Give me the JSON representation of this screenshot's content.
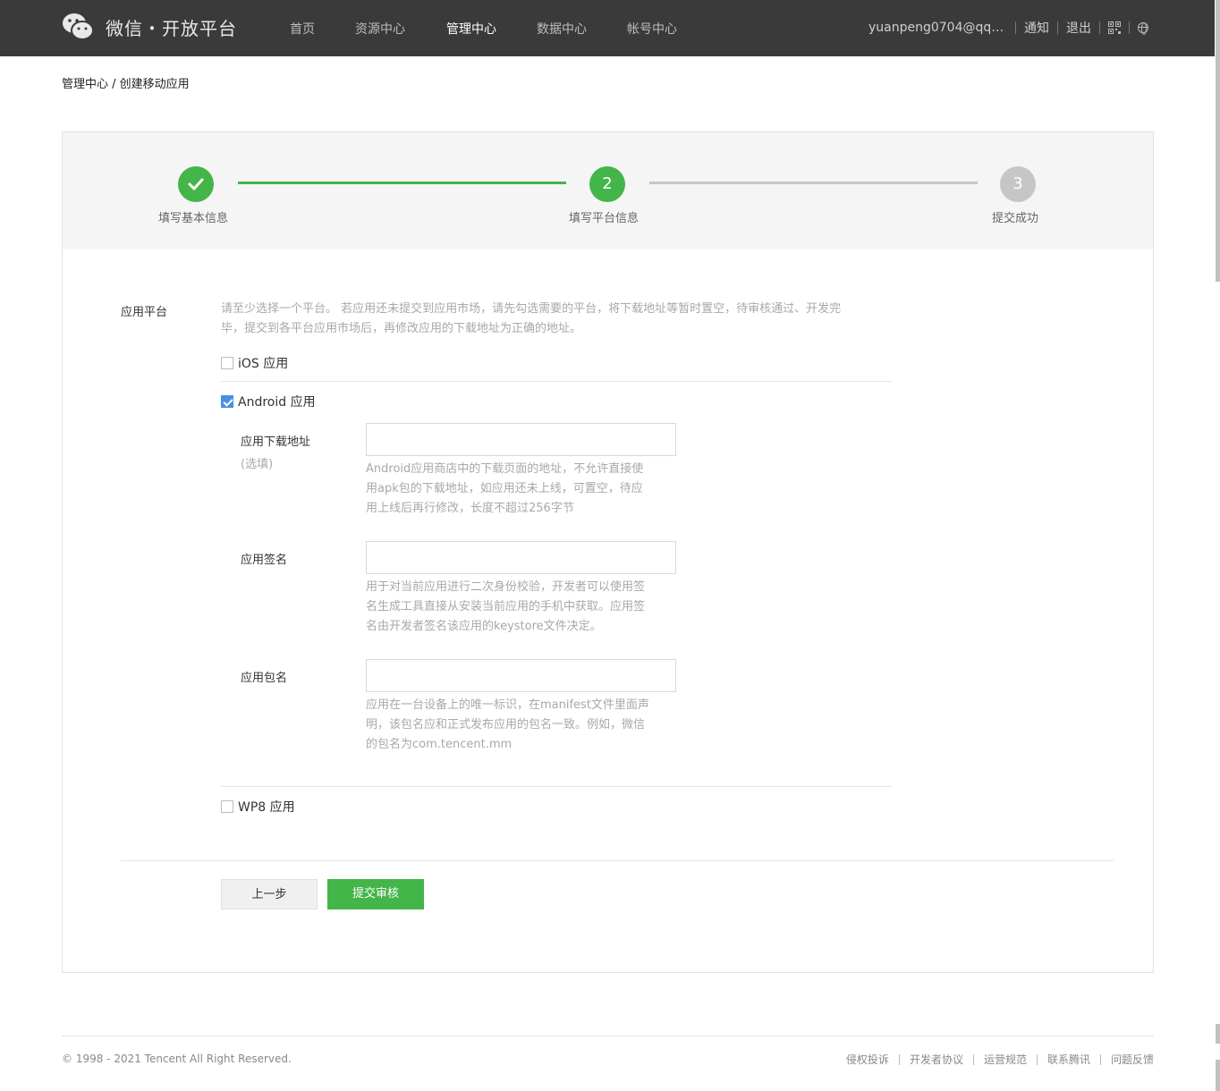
{
  "header": {
    "logo_text": "微信・开放平台",
    "nav": [
      "首页",
      "资源中心",
      "管理中心",
      "数据中心",
      "帐号中心"
    ],
    "active_nav": 2,
    "user_email": "yuanpeng0704@qq.c...",
    "notify": "通知",
    "logout": "退出"
  },
  "breadcrumb": "管理中心 / 创建移动应用",
  "steps": [
    {
      "label": "填写基本信息",
      "number": "",
      "state": "done"
    },
    {
      "label": "填写平台信息",
      "number": "2",
      "state": "current"
    },
    {
      "label": "提交成功",
      "number": "3",
      "state": "todo"
    }
  ],
  "platform": {
    "label": "应用平台",
    "hint_line1": "请至少选择一个平台。 若应用还未提交到应用市场，请先勾选需要的平台，将下载地址等暂时置空，待审核通过、开发完",
    "hint_line2": "毕，提交到各平台应用市场后，再修改应用的下载地址为正确的地址。",
    "ios": {
      "label": "iOS 应用",
      "checked": false
    },
    "android": {
      "label": "Android 应用",
      "checked": true
    },
    "wp8": {
      "label": "WP8 应用",
      "checked": false
    }
  },
  "android_fields": {
    "download": {
      "label": "应用下载地址",
      "optional": "(选填)",
      "value": "",
      "hint": [
        "Android应用商店中的下载页面的地址，不允许直接使",
        "用apk包的下载地址，如应用还未上线，可置空，待应",
        "用上线后再行修改，长度不超过256字节"
      ]
    },
    "signature": {
      "label": "应用签名",
      "value": "",
      "hint": [
        "用于对当前应用进行二次身份校验，开发者可以使用签",
        "名生成工具直接从安装当前应用的手机中获取。应用签",
        "名由开发者签名该应用的keystore文件决定。"
      ]
    },
    "package": {
      "label": "应用包名",
      "value": "",
      "hint": [
        "应用在一台设备上的唯一标识，在manifest文件里面声",
        "明，该包名应和正式发布应用的包名一致。例如，微信",
        "的包名为com.tencent.mm"
      ]
    }
  },
  "buttons": {
    "prev": "上一步",
    "submit": "提交审核"
  },
  "footer": {
    "copyright": "© 1998 - 2021 Tencent All Right Reserved.",
    "links": [
      "侵权投诉",
      "开发者协议",
      "运营规范",
      "联系腾讯",
      "问题反馈"
    ]
  },
  "colors": {
    "accent": "#44b549",
    "header_bg": "#3a3a3a",
    "inactive_step": "#c6c6c6"
  }
}
